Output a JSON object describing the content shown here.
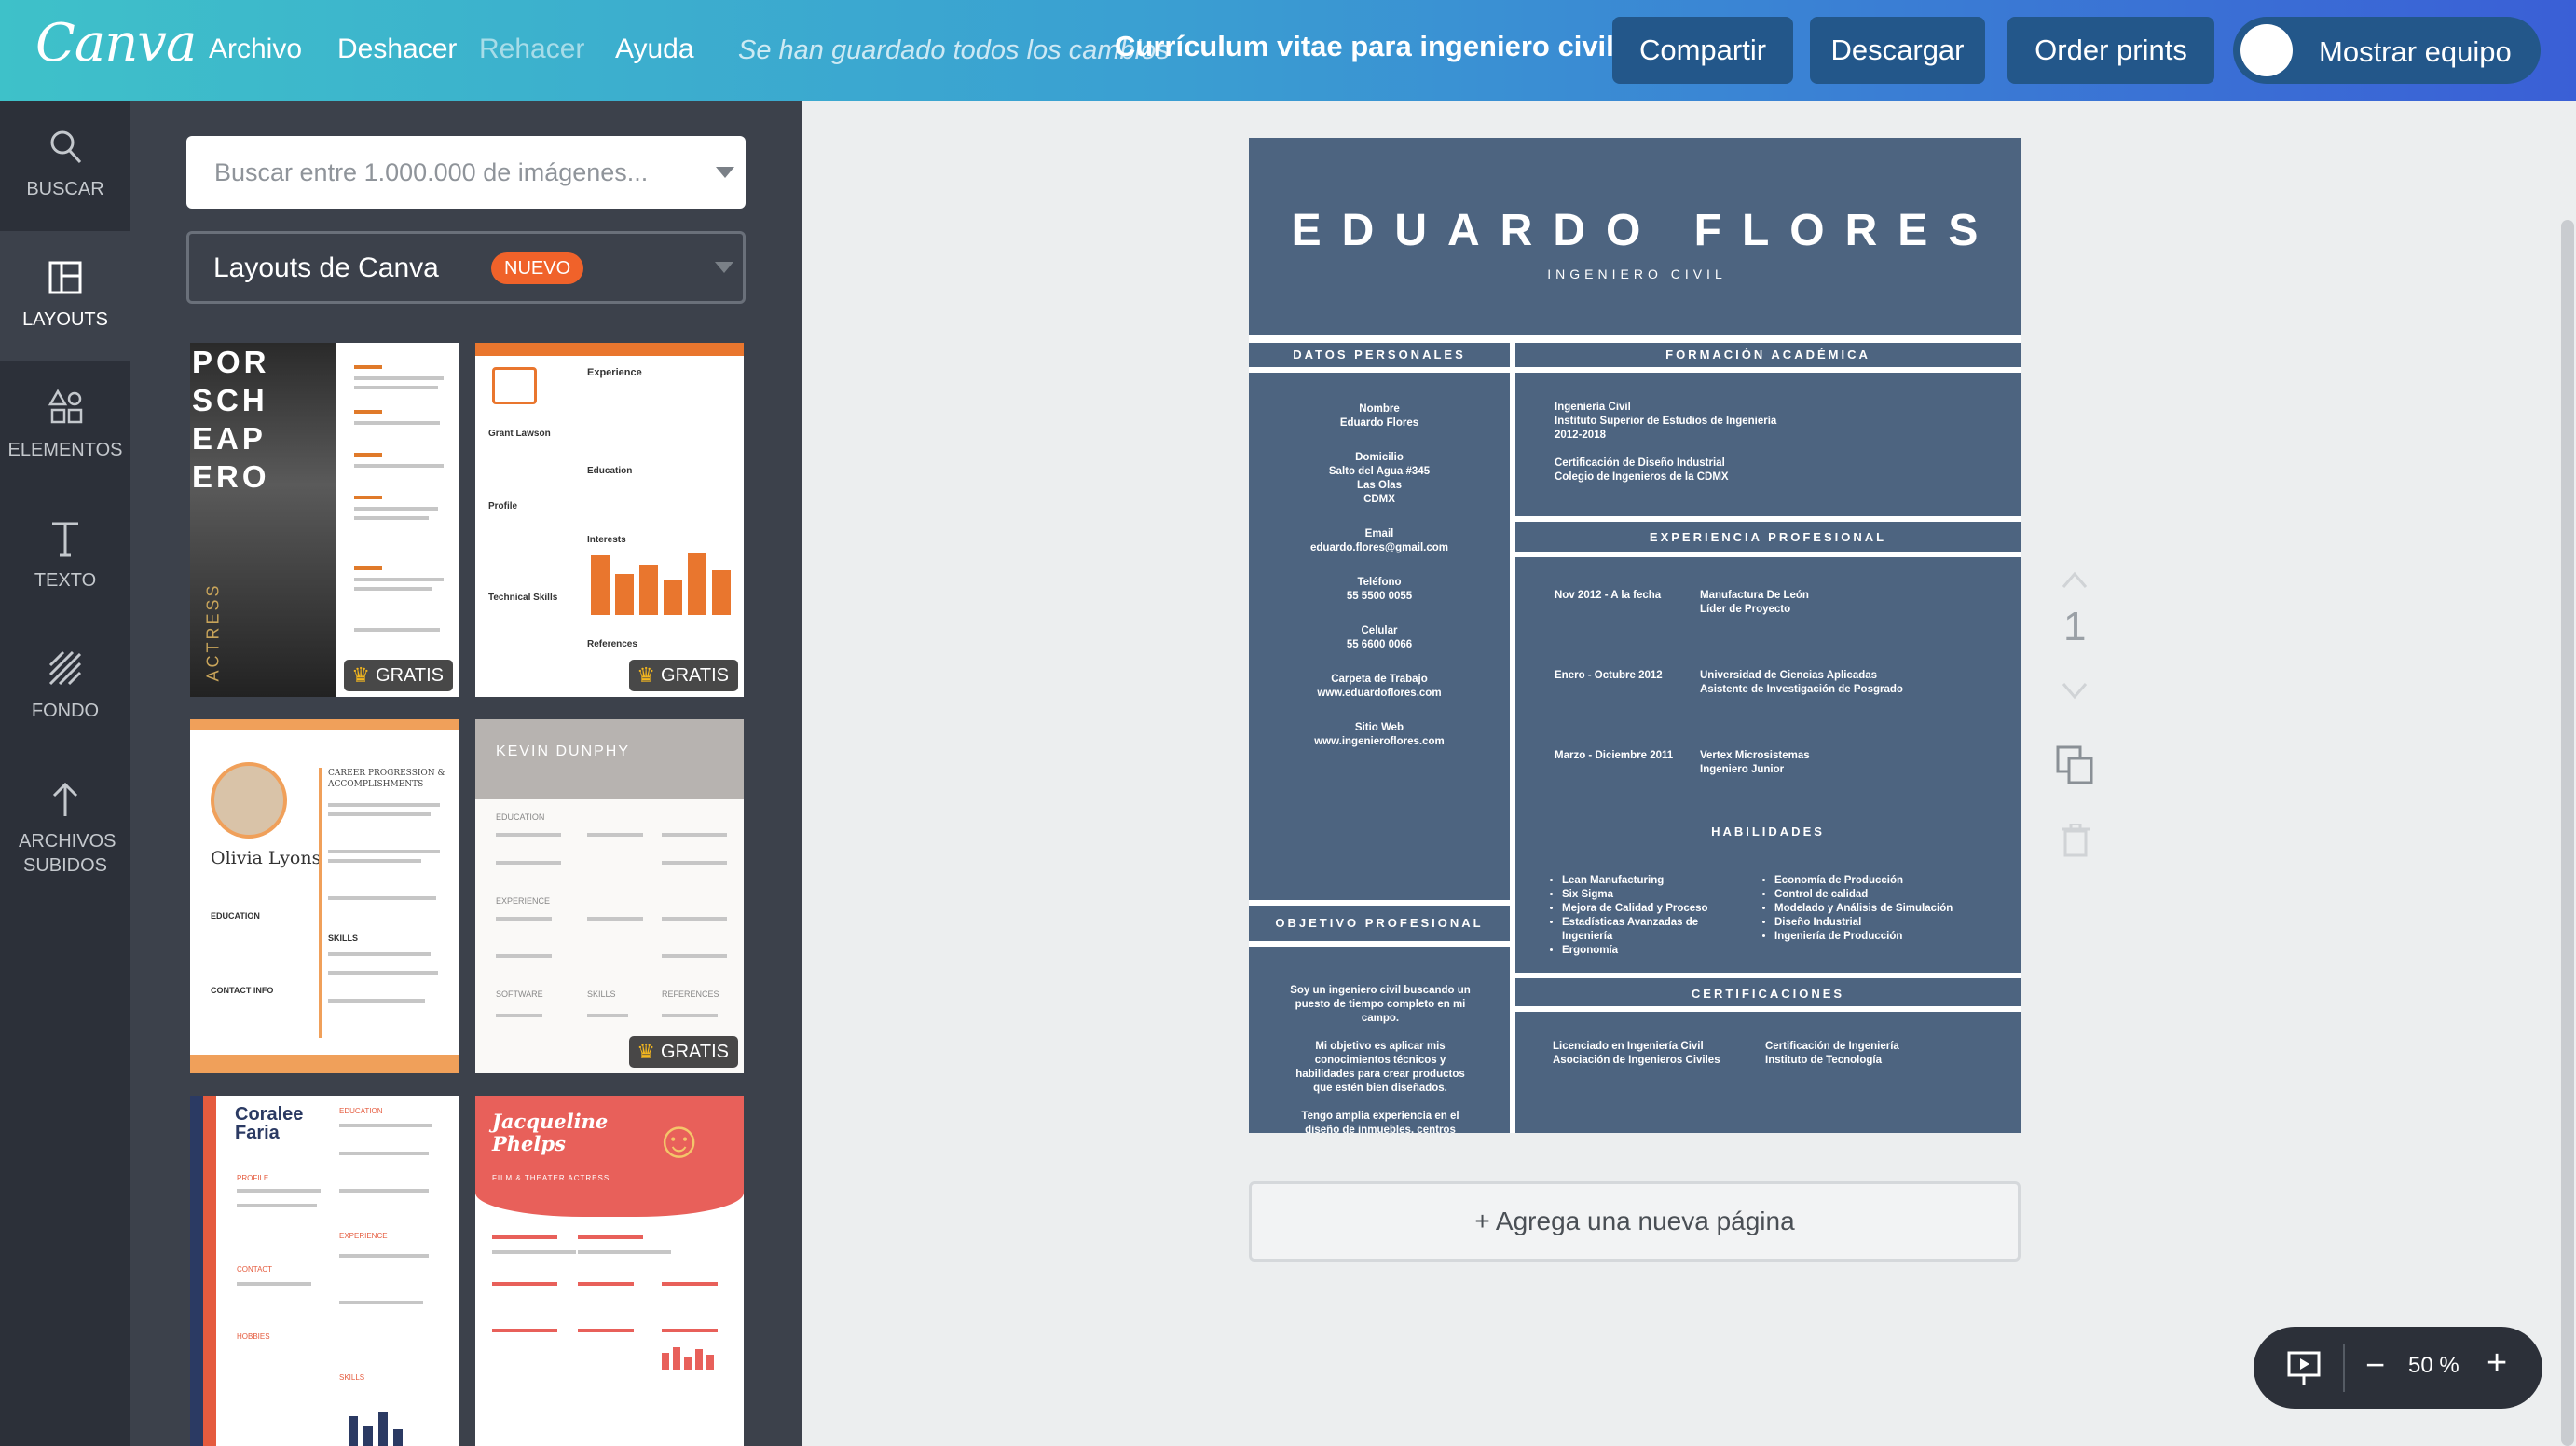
{
  "topbar": {
    "logo": "Canva",
    "menu": [
      "Archivo",
      "Deshacer",
      "Rehacer",
      "Ayuda"
    ],
    "save_status": "Se han guardado todos los cambios",
    "doc_title": "Currículum vitae para ingeniero civil",
    "share_label": "Compartir",
    "download_label": "Descargar",
    "print_label": "Order prints",
    "team_label": "Mostrar equipo"
  },
  "rail": {
    "items": [
      "BUSCAR",
      "LAYOUTS",
      "ELEMENTOS",
      "TEXTO",
      "FONDO",
      "ARCHIVOS SUBIDOS"
    ],
    "active": "LAYOUTS"
  },
  "panel": {
    "search_placeholder": "Buscar entre 1.000.000 de imágenes...",
    "layout_select": "Layouts de Canva",
    "new_badge": "NUEVO",
    "free_badge": "GRATIS",
    "templates": [
      {
        "heading": "POR SCH EAP ERO",
        "side": "ACTRESS",
        "free": true
      },
      {
        "heading": "Experience",
        "name": "Grant Lawson",
        "sections": [
          "Education",
          "Profile",
          "Interests",
          "Technical Skills",
          "References"
        ],
        "free": true
      },
      {
        "heading": "CAREER PROGRESSION & ACCOMPLISHMENTS",
        "name": "Olivia Lyons",
        "sections": [
          "EDUCATION",
          "CONTACT INFO",
          "SKILLS"
        ],
        "free": false
      },
      {
        "heading": "KEVIN DUNPHY",
        "sections": [
          "EDUCATION",
          "EXPERIENCE",
          "SOFTWARE",
          "SKILLS",
          "REFERENCES"
        ],
        "free": true
      },
      {
        "name": "Coralee Faria",
        "sections": [
          "EDUCATION",
          "PROFILE",
          "EXPERIENCE",
          "CONTACT",
          "HOBBIES",
          "SKILLS"
        ],
        "free": false
      },
      {
        "name": "Jacqueline Phelps",
        "subtitle": "FILM & THEATER ACTRESS",
        "free": false
      }
    ]
  },
  "resume": {
    "name": "EDUARDO FLORES",
    "title": "INGENIERO CIVIL",
    "sections": {
      "personal": "DATOS PERSONALES",
      "education": "FORMACIÓN ACADÉMICA",
      "experience": "EXPERIENCIA PROFESIONAL",
      "objective": "OBJETIVO PROFESIONAL",
      "skills": "HABILIDADES",
      "certifications": "CERTIFICACIONES"
    },
    "personal": [
      {
        "label": "Nombre",
        "value": "Eduardo Flores"
      },
      {
        "label": "Domicilio",
        "value": "Salto del Agua #345\nLas Olas\nCDMX"
      },
      {
        "label": "Email",
        "value": "eduardo.flores@gmail.com"
      },
      {
        "label": "Teléfono",
        "value": "55 5500 0055"
      },
      {
        "label": "Celular",
        "value": "55 6600 0066"
      },
      {
        "label": "Carpeta de Trabajo",
        "value": "www.eduardoflores.com"
      },
      {
        "label": "Sitio Web",
        "value": "www.ingenieroflores.com"
      }
    ],
    "education": [
      "Ingeniería Civil\nInstituto Superior de Estudios de Ingeniería\n2012-2018",
      "Certificación de Diseño Industrial\nColegio de Ingenieros de la CDMX"
    ],
    "experience": [
      {
        "date": "Nov 2012 - A la fecha",
        "detail": "Manufactura De León\nLíder de Proyecto"
      },
      {
        "date": "Enero - Octubre 2012",
        "detail": "Universidad de Ciencias Aplicadas\nAsistente de Investigación de Posgrado"
      },
      {
        "date": "Marzo - Diciembre 2011",
        "detail": "Vertex Microsistemas\nIngeniero Junior"
      }
    ],
    "objective": [
      "Soy un ingeniero civil buscando un puesto de tiempo completo en mi campo.",
      "Mi objetivo es aplicar mis conocimientos técnicos y habilidades para crear productos que estén bien diseñados.",
      "Tengo amplia experiencia en el diseño de inmuebles, centros comerciales y carreteras, así como siendo parte de un equipo de profesionales."
    ],
    "skills_left": [
      "Lean Manufacturing",
      "Six Sigma",
      "Mejora de Calidad y Proceso",
      "Estadísticas Avanzadas de Ingeniería",
      "Ergonomía"
    ],
    "skills_right": [
      "Economía de Producción",
      "Control de calidad",
      "Modelado y Análisis de Simulación",
      "Diseño Industrial",
      "Ingeniería de Producción"
    ],
    "certifications": [
      "Licenciado en Ingeniería Civil\nAsociación de Ingenieros Civiles",
      "Certificación de Ingeniería\nInstituto de Tecnología"
    ]
  },
  "canvas": {
    "add_page": "+ Agrega una nueva página",
    "page_number": "1",
    "zoom": "50 %"
  },
  "colors": {
    "resume_bg": "#4d6480",
    "accent_orange": "#f0622a",
    "rail_bg": "#2c3039",
    "panel_bg": "#3c414b",
    "button_bg": "#23578a"
  }
}
